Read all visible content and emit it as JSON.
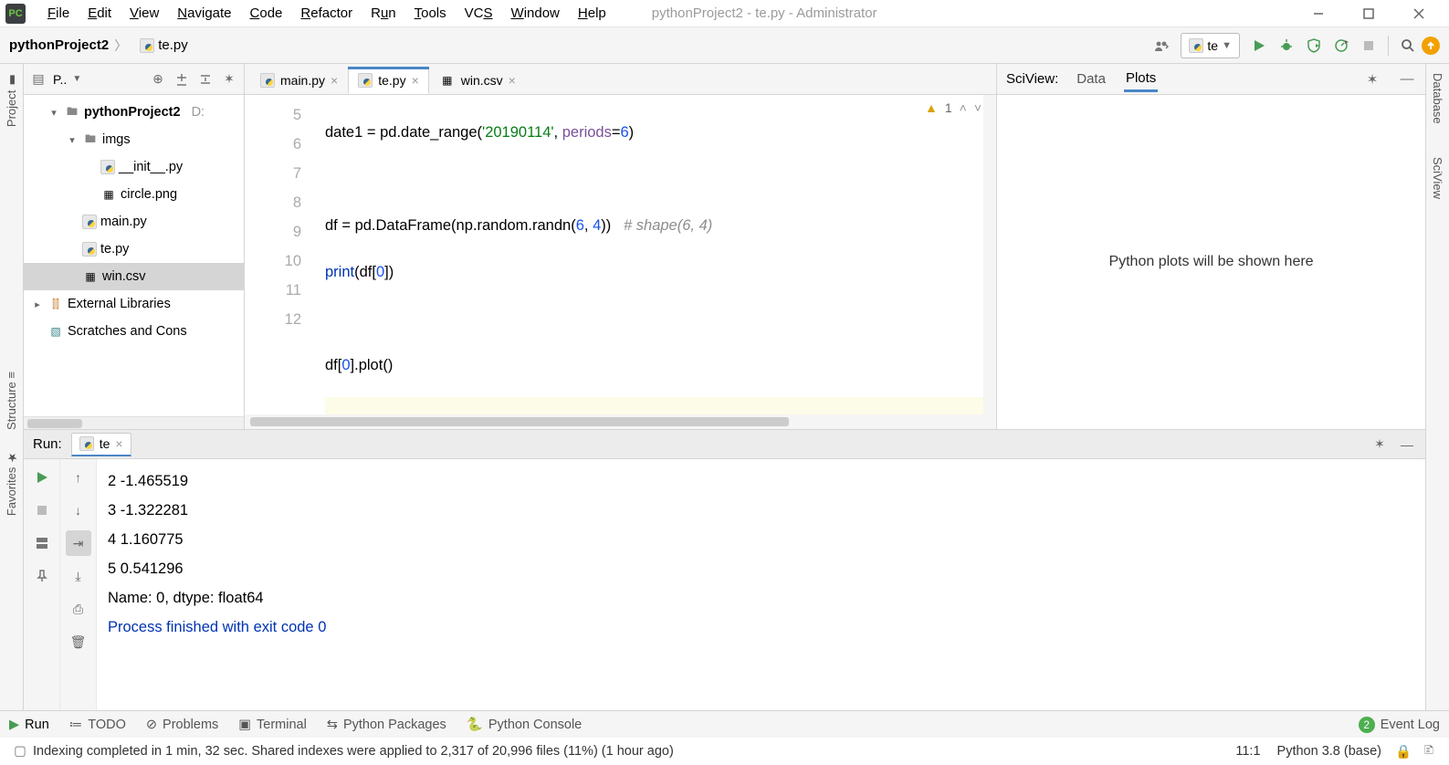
{
  "menu": [
    "File",
    "Edit",
    "View",
    "Navigate",
    "Code",
    "Refactor",
    "Run",
    "Tools",
    "VCS",
    "Window",
    "Help"
  ],
  "window_title": "pythonProject2 - te.py - Administrator",
  "breadcrumb": {
    "project": "pythonProject2",
    "file": "te.py"
  },
  "run_config_name": "te",
  "project_tool": {
    "title": "P..",
    "tree": {
      "root": "pythonProject2",
      "root_suffix": "D:",
      "imgs": "imgs",
      "init": "__init__.py",
      "circle": "circle.png",
      "main": "main.py",
      "te": "te.py",
      "win": "win.csv",
      "ext": "External Libraries",
      "scratch": "Scratches and Cons"
    }
  },
  "editor_tabs": [
    {
      "label": "main.py",
      "active": false
    },
    {
      "label": "te.py",
      "active": true
    },
    {
      "label": "win.csv",
      "active": false
    }
  ],
  "code_lines_start": 5,
  "code": {
    "l5_a": "date1 = pd.",
    "l5_fn": "date_range",
    "l5_b": "(",
    "l5_str": "'20190114'",
    "l5_c": ", ",
    "l5_kw": "periods",
    "l5_d": "=",
    "l5_num": "6",
    "l5_e": ")",
    "l7_a": "df = pd.",
    "l7_fn": "DataFrame",
    "l7_b": "(np.random.",
    "l7_fn2": "randn",
    "l7_c": "(",
    "l7_n1": "6",
    "l7_comma": ", ",
    "l7_n2": "4",
    "l7_d": "))   ",
    "l7_comment": "# shape(6, 4)",
    "l8_a": "print(df[",
    "l8_n": "0",
    "l8_b": "])",
    "l10_a": "df[",
    "l10_n": "0",
    "l10_b": "].",
    "l10_fn": "plot",
    "l10_c": "()"
  },
  "warnings_count": "1",
  "sciview": {
    "title": "SciView:",
    "tab_data": "Data",
    "tab_plots": "Plots",
    "placeholder": "Python plots will be shown here"
  },
  "run_tool": {
    "label": "Run:",
    "tab": "te",
    "output": [
      "2    -1.465519",
      "3    -1.322281",
      "4     1.160775",
      "5     0.541296",
      "Name: 0, dtype: float64",
      "",
      "Process finished with exit code 0"
    ]
  },
  "toolwindows": {
    "run": "Run",
    "todo": "TODO",
    "problems": "Problems",
    "terminal": "Terminal",
    "pypkg": "Python Packages",
    "pycon": "Python Console",
    "eventlog": "Event Log",
    "event_count": "2"
  },
  "status": {
    "msg": "Indexing completed in 1 min, 32 sec. Shared indexes were applied to 2,317 of 20,996 files (11%) (1 hour ago)",
    "pos": "11:1",
    "interpreter": "Python 3.8 (base)"
  },
  "left_tools": [
    "Project",
    "Structure",
    "Favorites"
  ],
  "right_tools": [
    "Database",
    "SciView"
  ]
}
